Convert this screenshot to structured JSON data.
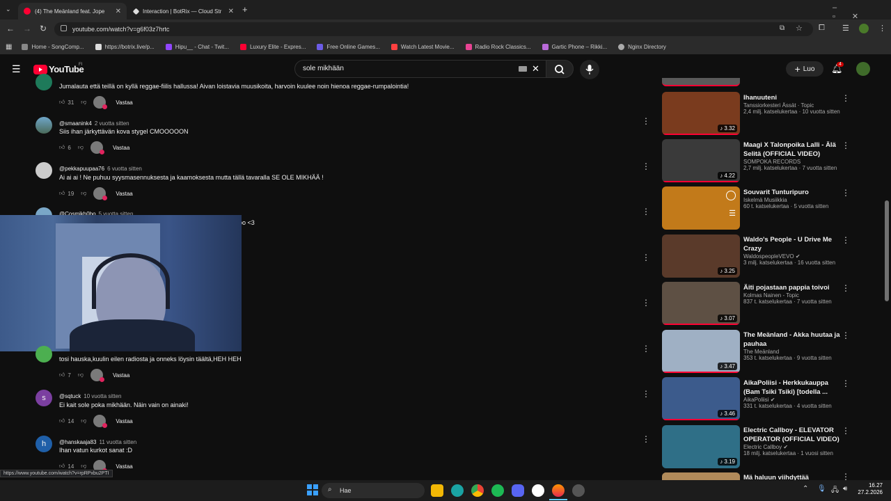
{
  "browser": {
    "tabs": [
      {
        "title": "(4) The Meänland feat. Jope",
        "active": true
      },
      {
        "title": "Interaction | BotRix — Cloud Str",
        "active": false
      }
    ],
    "url": "youtube.com/watch?v=g6f03z7hrtc",
    "bookmarks": [
      "Home - SongComp...",
      "https://botrix.live/p...",
      "Hipu__ - Chat - Twit...",
      "Luxury Elite - Expres...",
      "Free Online Games...",
      "Watch Latest Movie...",
      "Radio Rock Classics...",
      "Gartic Phone – Rikki...",
      "Nginx Directory"
    ],
    "status_url": "https://www.youtube.com/watch?v=rpRPxbu2PTI"
  },
  "yt": {
    "logo": "YouTube",
    "region": "FI",
    "search_value": "sole mikhään",
    "create_label": "Luo",
    "notif_count": "4"
  },
  "comments": [
    {
      "author": "",
      "time": "",
      "text": "Jumalauta että teillä on kyllä reggae-fiilis hallussa! Aivan loistavia muusikoita, harvoin kuulee noin hienoa reggae-rumpalointia!",
      "likes": "31",
      "reply": "Vastaa"
    },
    {
      "author": "@smaanink4",
      "time": "2 vuotta sitten",
      "text": "Siis ihan järkyttävän kova stygel   CMOOOOON",
      "likes": "6",
      "reply": "Vastaa"
    },
    {
      "author": "@pekkapuupaa76",
      "time": "6 vuotta sitten",
      "text": "Ai ai ai ! Ne puhuu syysmasennuksesta ja kaamoksesta mutta tällä tavaralla SE OLE MIKHÄÄ !",
      "likes": "19",
      "reply": "Vastaa"
    },
    {
      "author": "@Cosmikh0bo",
      "time": "5 vuotta sitten",
      "text": "oo <3",
      "likes": "",
      "reply": ""
    },
    {
      "author": "",
      "time": "",
      "text": "tosi hauska,kuulin eilen radiosta ja onneks löysin täältä,HEH HEH",
      "likes": "7",
      "reply": "Vastaa"
    },
    {
      "author": "@sqtuck",
      "time": "10 vuotta sitten",
      "text": "Ei kait sole poka mikhään. Näin vain on ainaki!",
      "likes": "14",
      "reply": "Vastaa"
    },
    {
      "author": "@hanskaaja83",
      "time": "11 vuotta sitten",
      "text": "Ihan vatun kurkot sanat :D",
      "likes": "14",
      "reply": "Vastaa"
    }
  ],
  "sidebar": [
    {
      "title": "Ihanuuteni",
      "channel": "Tanssiorkesteri Ässät · Topic",
      "meta": "2,4 milj. katselukertaa · 10 vuotta sitten",
      "duration": "3.32",
      "color": "#7a3b1e"
    },
    {
      "title": "Maagi X Talonpoika Lalli - Älä Selitä (OFFICIAL VIDEO)",
      "channel": "SOMPOKA RECORDS",
      "meta": "2,7 milj. katselukertaa · 7 vuotta sitten",
      "duration": "4.22",
      "color": "#3a3a3a"
    },
    {
      "title": "Souvarit Tunturipuro",
      "channel": "Iskelmä Musiikkia",
      "meta": "60 t. katselukertaa · 5 vuotta sitten",
      "duration": "",
      "color": "#c27a1a"
    },
    {
      "title": "Waldo's People - U Drive Me Crazy",
      "channel": "WaldospeopleVEVO",
      "meta": "3 milj. katselukertaa · 16 vuotta sitten",
      "duration": "3.25",
      "color": "#5a3a2a"
    },
    {
      "title": "Äiti pojastaan pappia toivoi",
      "channel": "Kolmas Nainen - Topic",
      "meta": "837 t. katselukertaa · 7 vuotta sitten",
      "duration": "3.07",
      "color": "#5e5044"
    },
    {
      "title": "The Meänland - Akka huutaa ja pauhaa",
      "channel": "The Meänland",
      "meta": "353 t. katselukertaa · 9 vuotta sitten",
      "duration": "3.47",
      "color": "#9fb0c4"
    },
    {
      "title": "AikaPoliisi - Herkkukauppa (Bam Tsiki Tsiki) [todella ...",
      "channel": "AikaPoliisi",
      "meta": "331 t. katselukertaa · 4 vuotta sitten",
      "duration": "3.46",
      "color": "#3c5b8c"
    },
    {
      "title": "Electric Callboy - ELEVATOR OPERATOR (OFFICIAL VIDEO)",
      "channel": "Electric Callboy",
      "meta": "18 milj. katselukertaa · 1 vuosi sitten",
      "duration": "3.19",
      "color": "#2f6f87"
    },
    {
      "title": "Mä haluun viihdyttää",
      "channel": "",
      "meta": "",
      "duration": "",
      "color": "#b08a5a"
    }
  ],
  "taskbar": {
    "search_label": "Hae",
    "time": "16.27",
    "date": "27.2.2026"
  }
}
